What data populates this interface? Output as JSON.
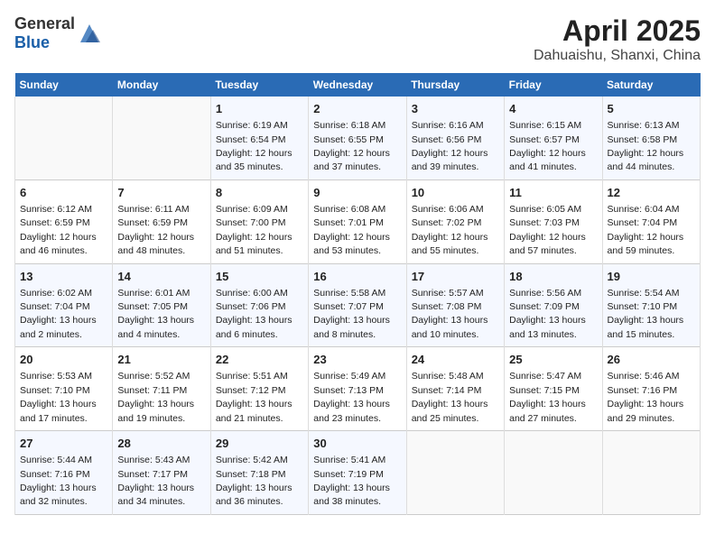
{
  "header": {
    "logo_general": "General",
    "logo_blue": "Blue",
    "title": "April 2025",
    "subtitle": "Dahuaishu, Shanxi, China"
  },
  "days_of_week": [
    "Sunday",
    "Monday",
    "Tuesday",
    "Wednesday",
    "Thursday",
    "Friday",
    "Saturday"
  ],
  "weeks": [
    {
      "cells": [
        {
          "day": null,
          "info": null
        },
        {
          "day": null,
          "info": null
        },
        {
          "day": "1",
          "info": "Sunrise: 6:19 AM\nSunset: 6:54 PM\nDaylight: 12 hours\nand 35 minutes."
        },
        {
          "day": "2",
          "info": "Sunrise: 6:18 AM\nSunset: 6:55 PM\nDaylight: 12 hours\nand 37 minutes."
        },
        {
          "day": "3",
          "info": "Sunrise: 6:16 AM\nSunset: 6:56 PM\nDaylight: 12 hours\nand 39 minutes."
        },
        {
          "day": "4",
          "info": "Sunrise: 6:15 AM\nSunset: 6:57 PM\nDaylight: 12 hours\nand 41 minutes."
        },
        {
          "day": "5",
          "info": "Sunrise: 6:13 AM\nSunset: 6:58 PM\nDaylight: 12 hours\nand 44 minutes."
        }
      ]
    },
    {
      "cells": [
        {
          "day": "6",
          "info": "Sunrise: 6:12 AM\nSunset: 6:59 PM\nDaylight: 12 hours\nand 46 minutes."
        },
        {
          "day": "7",
          "info": "Sunrise: 6:11 AM\nSunset: 6:59 PM\nDaylight: 12 hours\nand 48 minutes."
        },
        {
          "day": "8",
          "info": "Sunrise: 6:09 AM\nSunset: 7:00 PM\nDaylight: 12 hours\nand 51 minutes."
        },
        {
          "day": "9",
          "info": "Sunrise: 6:08 AM\nSunset: 7:01 PM\nDaylight: 12 hours\nand 53 minutes."
        },
        {
          "day": "10",
          "info": "Sunrise: 6:06 AM\nSunset: 7:02 PM\nDaylight: 12 hours\nand 55 minutes."
        },
        {
          "day": "11",
          "info": "Sunrise: 6:05 AM\nSunset: 7:03 PM\nDaylight: 12 hours\nand 57 minutes."
        },
        {
          "day": "12",
          "info": "Sunrise: 6:04 AM\nSunset: 7:04 PM\nDaylight: 12 hours\nand 59 minutes."
        }
      ]
    },
    {
      "cells": [
        {
          "day": "13",
          "info": "Sunrise: 6:02 AM\nSunset: 7:04 PM\nDaylight: 13 hours\nand 2 minutes."
        },
        {
          "day": "14",
          "info": "Sunrise: 6:01 AM\nSunset: 7:05 PM\nDaylight: 13 hours\nand 4 minutes."
        },
        {
          "day": "15",
          "info": "Sunrise: 6:00 AM\nSunset: 7:06 PM\nDaylight: 13 hours\nand 6 minutes."
        },
        {
          "day": "16",
          "info": "Sunrise: 5:58 AM\nSunset: 7:07 PM\nDaylight: 13 hours\nand 8 minutes."
        },
        {
          "day": "17",
          "info": "Sunrise: 5:57 AM\nSunset: 7:08 PM\nDaylight: 13 hours\nand 10 minutes."
        },
        {
          "day": "18",
          "info": "Sunrise: 5:56 AM\nSunset: 7:09 PM\nDaylight: 13 hours\nand 13 minutes."
        },
        {
          "day": "19",
          "info": "Sunrise: 5:54 AM\nSunset: 7:10 PM\nDaylight: 13 hours\nand 15 minutes."
        }
      ]
    },
    {
      "cells": [
        {
          "day": "20",
          "info": "Sunrise: 5:53 AM\nSunset: 7:10 PM\nDaylight: 13 hours\nand 17 minutes."
        },
        {
          "day": "21",
          "info": "Sunrise: 5:52 AM\nSunset: 7:11 PM\nDaylight: 13 hours\nand 19 minutes."
        },
        {
          "day": "22",
          "info": "Sunrise: 5:51 AM\nSunset: 7:12 PM\nDaylight: 13 hours\nand 21 minutes."
        },
        {
          "day": "23",
          "info": "Sunrise: 5:49 AM\nSunset: 7:13 PM\nDaylight: 13 hours\nand 23 minutes."
        },
        {
          "day": "24",
          "info": "Sunrise: 5:48 AM\nSunset: 7:14 PM\nDaylight: 13 hours\nand 25 minutes."
        },
        {
          "day": "25",
          "info": "Sunrise: 5:47 AM\nSunset: 7:15 PM\nDaylight: 13 hours\nand 27 minutes."
        },
        {
          "day": "26",
          "info": "Sunrise: 5:46 AM\nSunset: 7:16 PM\nDaylight: 13 hours\nand 29 minutes."
        }
      ]
    },
    {
      "cells": [
        {
          "day": "27",
          "info": "Sunrise: 5:44 AM\nSunset: 7:16 PM\nDaylight: 13 hours\nand 32 minutes."
        },
        {
          "day": "28",
          "info": "Sunrise: 5:43 AM\nSunset: 7:17 PM\nDaylight: 13 hours\nand 34 minutes."
        },
        {
          "day": "29",
          "info": "Sunrise: 5:42 AM\nSunset: 7:18 PM\nDaylight: 13 hours\nand 36 minutes."
        },
        {
          "day": "30",
          "info": "Sunrise: 5:41 AM\nSunset: 7:19 PM\nDaylight: 13 hours\nand 38 minutes."
        },
        {
          "day": null,
          "info": null
        },
        {
          "day": null,
          "info": null
        },
        {
          "day": null,
          "info": null
        }
      ]
    }
  ]
}
